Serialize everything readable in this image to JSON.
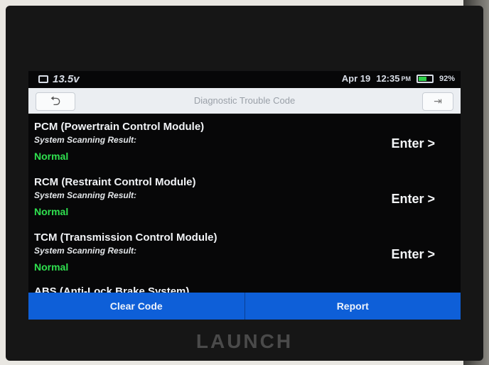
{
  "status_bar": {
    "voltage": "13.5v",
    "date": "Apr 19",
    "time": "12:35",
    "ampm": "PM",
    "battery_percent": "92%",
    "battery_level": 0.6
  },
  "header": {
    "title": "Diagnostic Trouble Code",
    "back_icon": "back-arrow-icon",
    "exit_icon": "exit-icon"
  },
  "modules": [
    {
      "name": "PCM (Powertrain Control Module)",
      "scan_label": "System Scanning Result:",
      "status": "Normal",
      "enter_label": "Enter >"
    },
    {
      "name": "RCM (Restraint Control Module)",
      "scan_label": "System Scanning Result:",
      "status": "Normal",
      "enter_label": "Enter >"
    },
    {
      "name": "TCM (Transmission Control Module)",
      "scan_label": "System Scanning Result:",
      "status": "Normal",
      "enter_label": "Enter >"
    },
    {
      "name": "ABS (Anti-Lock Brake System)"
    }
  ],
  "actions": {
    "clear_code": "Clear Code",
    "report": "Report"
  },
  "brand": "LAUNCH",
  "colors": {
    "accent_blue": "#0e5fd8",
    "status_normal": "#2fe04f",
    "battery_green": "#2fd04a"
  }
}
